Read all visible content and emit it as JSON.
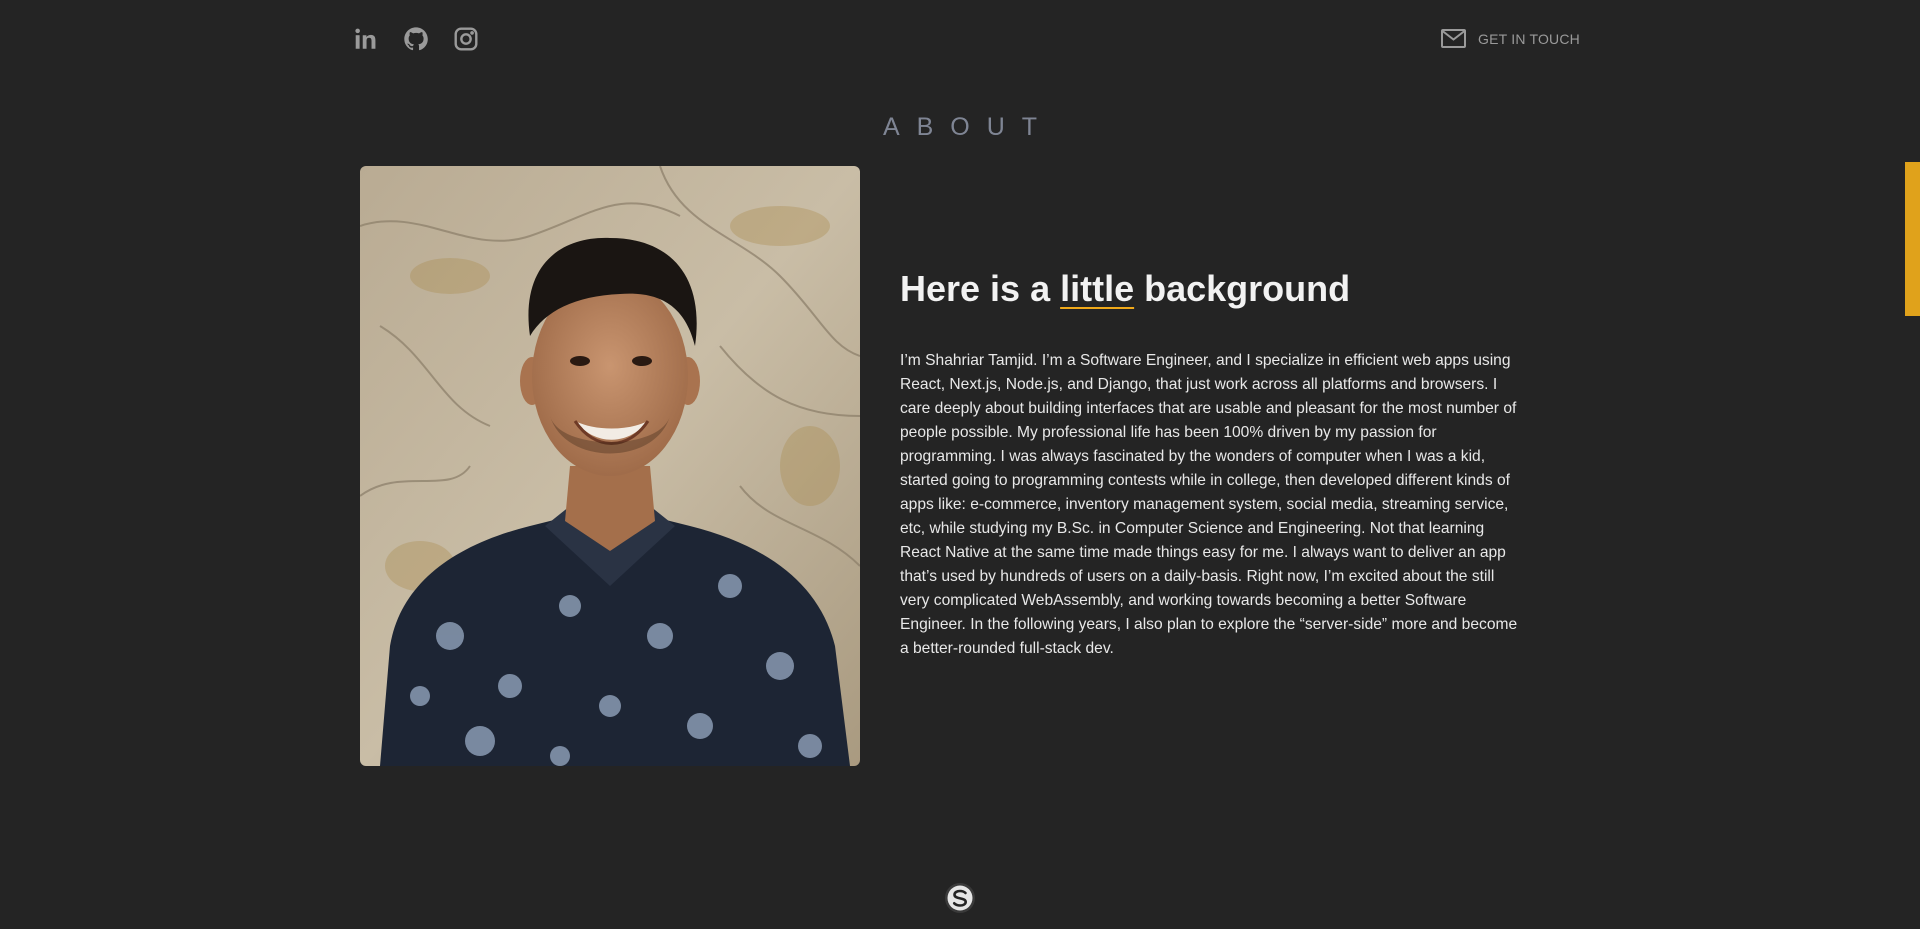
{
  "header": {
    "social": [
      {
        "icon": "linkedin-icon"
      },
      {
        "icon": "github-icon"
      },
      {
        "icon": "instagram-icon"
      }
    ],
    "contact_label": "GET IN TOUCH",
    "contact_icon": "mail-icon"
  },
  "about": {
    "title": "ABOUT",
    "heading_before": "Here is a ",
    "heading_highlight": "little",
    "heading_after": " background",
    "bio": "I’m Shahriar Tamjid. I’m a Software Engineer, and I specialize in efficient web apps using React, Next.js, Node.js, and Django, that just work across all platforms and browsers. I care deeply about building interfaces that are usable and pleasant for the most number of people possible. My professional life has been 100% driven by my passion for programming. I was always fascinated by the wonders of computer when I was a kid, started going to programming contests while in college, then developed different kinds of apps like: e-commerce, inventory management system, social media, streaming service, etc, while studying my B.Sc. in Computer Science and Engineering. Not that learning React Native at the same time made things easy for me. I always want to deliver an app that’s used by hundreds of users on a daily-basis. Right now, I’m excited about the still very complicated WebAssembly, and working towards becoming a better Software Engineer. In the following years, I also plan to explore the “server-side” more and become a better-rounded full-stack dev."
  },
  "colors": {
    "background": "#242424",
    "accent": "#e0a21b",
    "muted": "#9a9a9a",
    "title": "#7f8594"
  }
}
